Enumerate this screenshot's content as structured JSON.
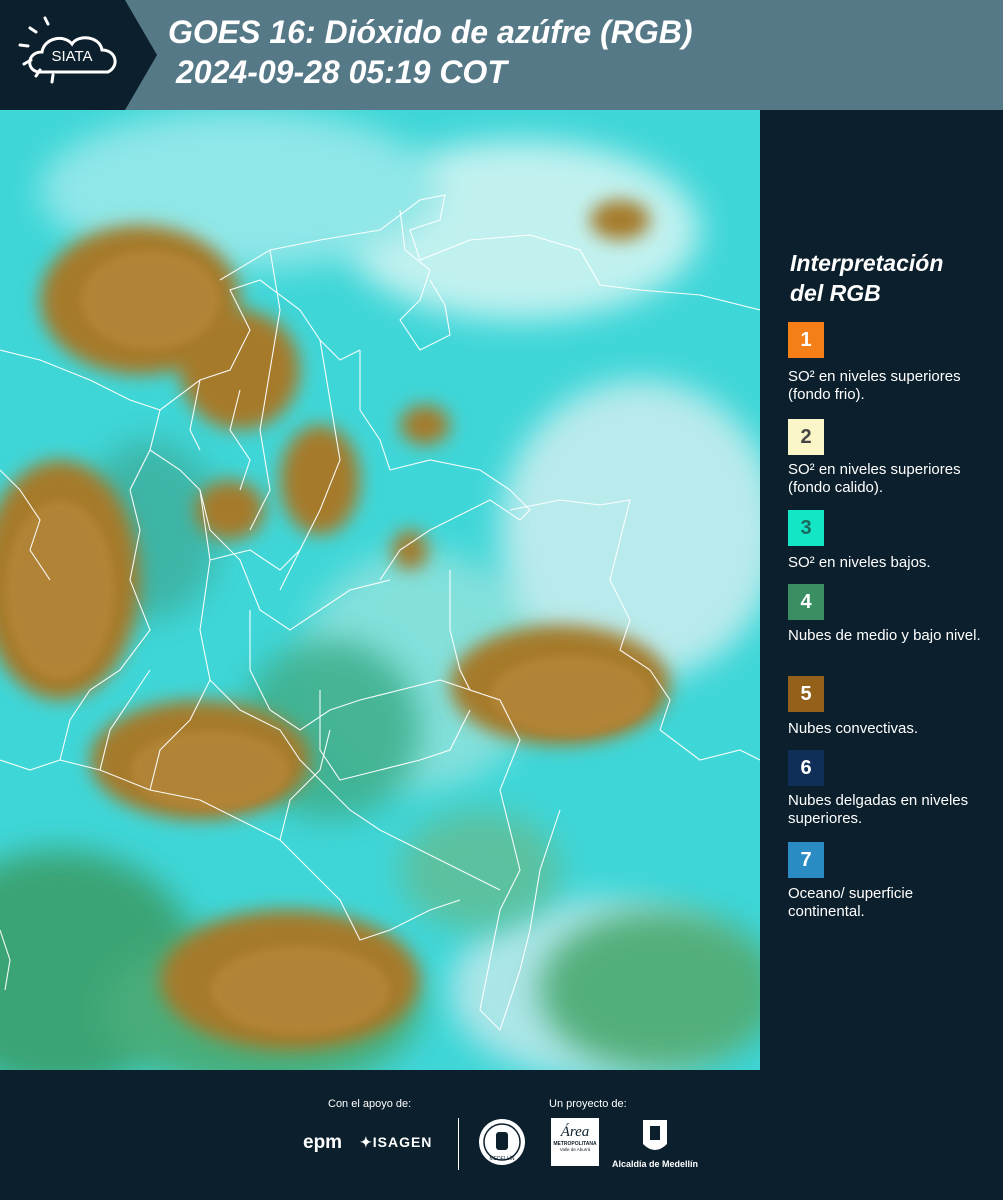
{
  "header": {
    "logo_text": "SIATA",
    "title_line1": "GOES 16: Dióxido de azúfre (RGB)",
    "title_line2": "2024-09-28 05:19 COT"
  },
  "legend": {
    "title_line1": "Interpretación",
    "title_line2": "del RGB",
    "items": [
      {
        "number": "1",
        "color": "#f47f17",
        "text_color": "#ffffff",
        "description": "SO² en niveles superiores (fondo frio)."
      },
      {
        "number": "2",
        "color": "#fbf6c8",
        "text_color": "#444444",
        "description": "SO² en niveles superiores (fondo calido)."
      },
      {
        "number": "3",
        "color": "#13e6c4",
        "text_color": "#1a6a60",
        "description": "SO² en niveles bajos."
      },
      {
        "number": "4",
        "color": "#3a8f62",
        "text_color": "#ffffff",
        "description": "Nubes de medio y bajo nivel."
      },
      {
        "number": "5",
        "color": "#94611a",
        "text_color": "#ffffff",
        "description": "Nubes convectivas."
      },
      {
        "number": "6",
        "color": "#0f2f59",
        "text_color": "#ffffff",
        "description": "Nubes delgadas en niveles superiores."
      },
      {
        "number": "7",
        "color": "#2a8cc2",
        "text_color": "#ffffff",
        "description": "Oceano/ superficie continental."
      }
    ]
  },
  "footer": {
    "support_label": "Con el apoyo de:",
    "project_label": "Un proyecto de:",
    "sponsor1": "epm",
    "sponsor2": "ISAGEN",
    "partner_area_line1": "Área",
    "partner_area_line2": "METROPOLITANA",
    "partner_area_line3": "Valle de Aburrá",
    "partner_alcaldia": "Alcaldía de Medellín",
    "seal_text": "MEDELLÍN"
  }
}
